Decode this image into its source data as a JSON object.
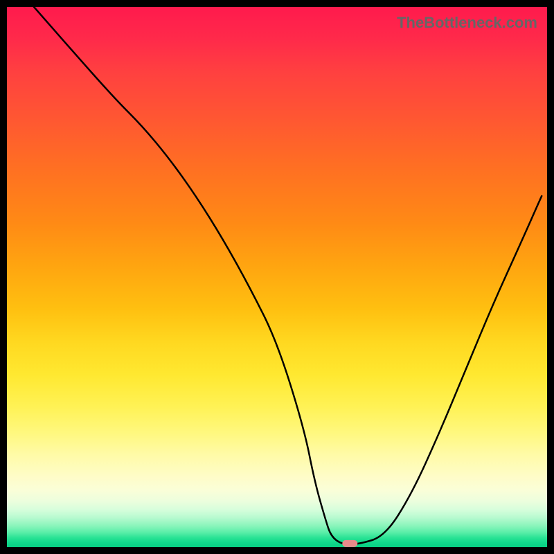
{
  "watermark": "TheBottleneck.com",
  "chart_data": {
    "type": "line",
    "title": "",
    "xlabel": "",
    "ylabel": "",
    "xlim": [
      0,
      100
    ],
    "ylim": [
      0,
      100
    ],
    "grid": false,
    "series": [
      {
        "name": "bottleneck-curve",
        "x_percent": [
          5,
          12,
          20,
          25,
          30,
          35,
          40,
          45,
          50,
          55,
          57,
          59,
          60,
          62,
          65,
          70,
          75,
          80,
          85,
          90,
          95,
          99
        ],
        "y_percent": [
          100,
          92,
          83,
          78,
          72,
          65,
          57,
          48,
          38,
          22,
          12,
          5,
          2,
          0.5,
          0.5,
          2,
          10,
          21,
          33,
          45,
          56,
          65
        ]
      }
    ],
    "marker": {
      "name": "optimal-point",
      "x_percent": 63.5,
      "y_percent": 0.4,
      "color": "#e88b8a",
      "shape": "pill"
    },
    "gradient_stops": [
      {
        "pos": 0.0,
        "color": "#ff1a4d"
      },
      {
        "pos": 0.5,
        "color": "#ffc010"
      },
      {
        "pos": 0.85,
        "color": "#fff880"
      },
      {
        "pos": 1.0,
        "color": "#08ce82"
      }
    ]
  }
}
